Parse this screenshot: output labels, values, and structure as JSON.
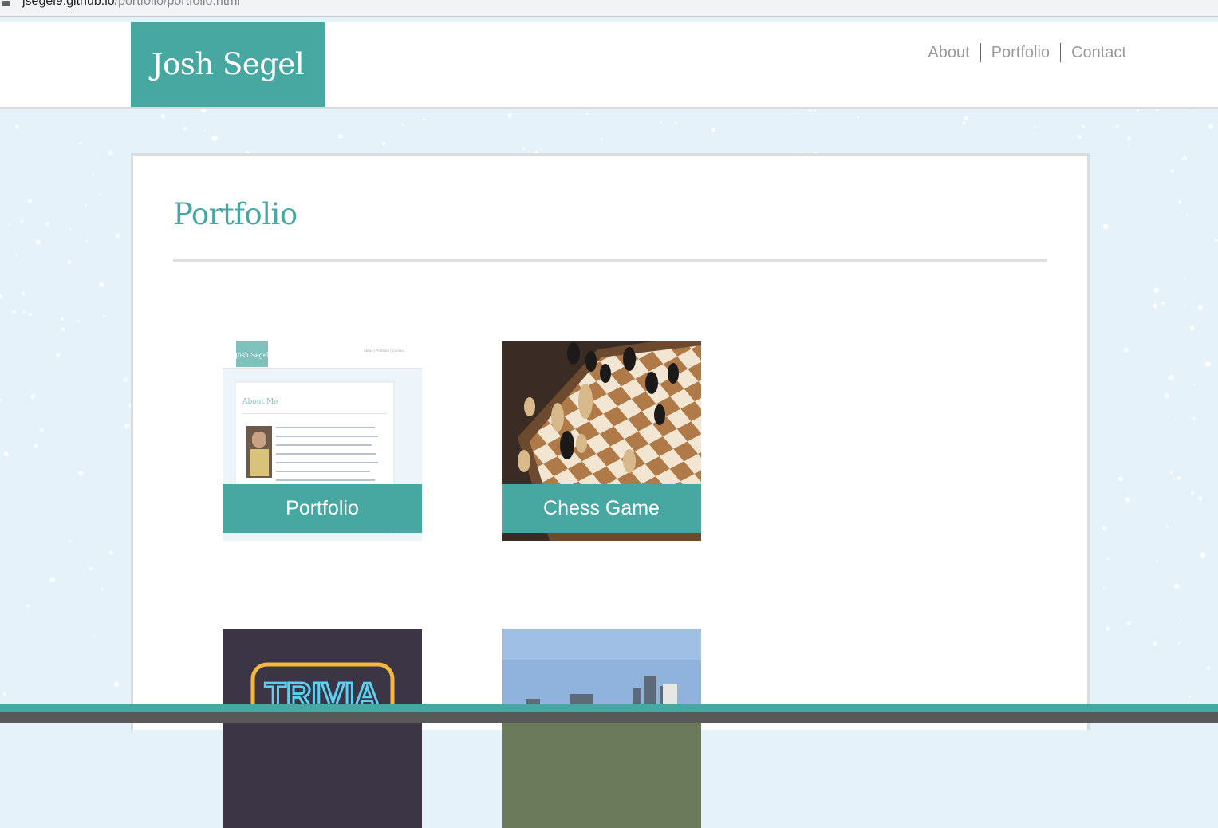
{
  "browser": {
    "url_host": "jsegel9.github.io",
    "url_path": "/portfolio/portfolio.html"
  },
  "header": {
    "brand": "Josh Segel",
    "nav": [
      {
        "label": "About"
      },
      {
        "label": "Portfolio"
      },
      {
        "label": "Contact"
      }
    ]
  },
  "main": {
    "title": "Portfolio",
    "projects": [
      {
        "caption": "Portfolio"
      },
      {
        "caption": "Chess Game"
      },
      {
        "caption": ""
      },
      {
        "caption": ""
      }
    ],
    "thumbnails": {
      "portfolio_preview": {
        "brand": "Josh Segel",
        "nav": "About | Portfolio | Contact",
        "heading": "About Me"
      },
      "trivia_sign": "TRIVIA"
    }
  },
  "colors": {
    "accent": "#47a8a2",
    "nav_text": "#9a9a9a",
    "background": "#e6f2f9",
    "footer_dark": "#595959"
  }
}
